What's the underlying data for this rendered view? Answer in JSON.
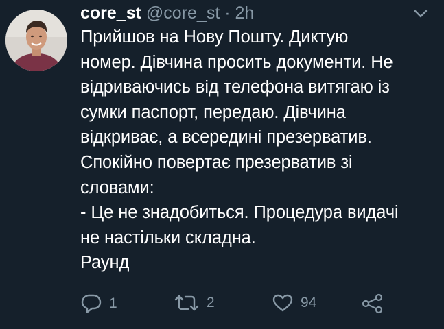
{
  "user": {
    "display_name": "core_st",
    "handle": "@core_st",
    "separator": "·",
    "timestamp": "2h"
  },
  "tweet": {
    "lines": [
      "Прийшов на Нову Пошту. Диктую",
      "номер. Дівчина просить документи. Не",
      "відриваючись від телефона витягаю із",
      "сумки паспорт, передаю. Дівчина",
      "відкриває, а всередині презерватив.",
      "Спокійно повертає презерватив зі",
      "словами:",
      "- Це не знадобиться. Процедура видачі",
      "не настільки складна.",
      "Раунд"
    ]
  },
  "actions": {
    "reply_count": "1",
    "retweet_count": "2",
    "like_count": "94"
  },
  "icons": {
    "menu": "chevron-down-icon",
    "reply": "reply-icon",
    "retweet": "retweet-icon",
    "like": "heart-icon",
    "share": "share-icon"
  },
  "colors": {
    "background": "#15202b",
    "text": "#ffffff",
    "secondary": "#8899a6"
  }
}
